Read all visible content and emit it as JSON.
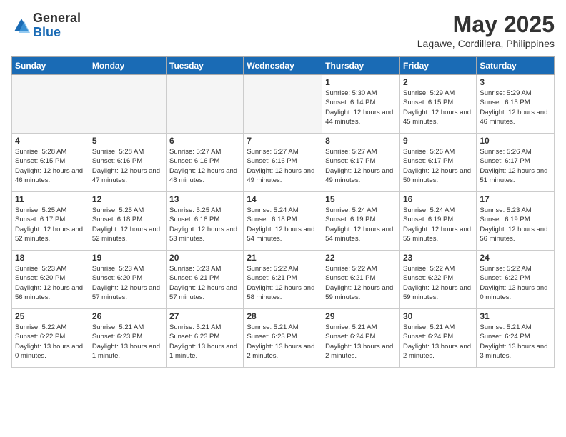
{
  "header": {
    "logo_general": "General",
    "logo_blue": "Blue",
    "month_title": "May 2025",
    "subtitle": "Lagawe, Cordillera, Philippines"
  },
  "weekdays": [
    "Sunday",
    "Monday",
    "Tuesday",
    "Wednesday",
    "Thursday",
    "Friday",
    "Saturday"
  ],
  "weeks": [
    [
      {
        "day": "",
        "sunrise": "",
        "sunset": "",
        "daylight": "",
        "empty": true
      },
      {
        "day": "",
        "sunrise": "",
        "sunset": "",
        "daylight": "",
        "empty": true
      },
      {
        "day": "",
        "sunrise": "",
        "sunset": "",
        "daylight": "",
        "empty": true
      },
      {
        "day": "",
        "sunrise": "",
        "sunset": "",
        "daylight": "",
        "empty": true
      },
      {
        "day": "1",
        "sunrise": "Sunrise: 5:30 AM",
        "sunset": "Sunset: 6:14 PM",
        "daylight": "Daylight: 12 hours and 44 minutes.",
        "empty": false
      },
      {
        "day": "2",
        "sunrise": "Sunrise: 5:29 AM",
        "sunset": "Sunset: 6:15 PM",
        "daylight": "Daylight: 12 hours and 45 minutes.",
        "empty": false
      },
      {
        "day": "3",
        "sunrise": "Sunrise: 5:29 AM",
        "sunset": "Sunset: 6:15 PM",
        "daylight": "Daylight: 12 hours and 46 minutes.",
        "empty": false
      }
    ],
    [
      {
        "day": "4",
        "sunrise": "Sunrise: 5:28 AM",
        "sunset": "Sunset: 6:15 PM",
        "daylight": "Daylight: 12 hours and 46 minutes.",
        "empty": false
      },
      {
        "day": "5",
        "sunrise": "Sunrise: 5:28 AM",
        "sunset": "Sunset: 6:16 PM",
        "daylight": "Daylight: 12 hours and 47 minutes.",
        "empty": false
      },
      {
        "day": "6",
        "sunrise": "Sunrise: 5:27 AM",
        "sunset": "Sunset: 6:16 PM",
        "daylight": "Daylight: 12 hours and 48 minutes.",
        "empty": false
      },
      {
        "day": "7",
        "sunrise": "Sunrise: 5:27 AM",
        "sunset": "Sunset: 6:16 PM",
        "daylight": "Daylight: 12 hours and 49 minutes.",
        "empty": false
      },
      {
        "day": "8",
        "sunrise": "Sunrise: 5:27 AM",
        "sunset": "Sunset: 6:17 PM",
        "daylight": "Daylight: 12 hours and 49 minutes.",
        "empty": false
      },
      {
        "day": "9",
        "sunrise": "Sunrise: 5:26 AM",
        "sunset": "Sunset: 6:17 PM",
        "daylight": "Daylight: 12 hours and 50 minutes.",
        "empty": false
      },
      {
        "day": "10",
        "sunrise": "Sunrise: 5:26 AM",
        "sunset": "Sunset: 6:17 PM",
        "daylight": "Daylight: 12 hours and 51 minutes.",
        "empty": false
      }
    ],
    [
      {
        "day": "11",
        "sunrise": "Sunrise: 5:25 AM",
        "sunset": "Sunset: 6:17 PM",
        "daylight": "Daylight: 12 hours and 52 minutes.",
        "empty": false
      },
      {
        "day": "12",
        "sunrise": "Sunrise: 5:25 AM",
        "sunset": "Sunset: 6:18 PM",
        "daylight": "Daylight: 12 hours and 52 minutes.",
        "empty": false
      },
      {
        "day": "13",
        "sunrise": "Sunrise: 5:25 AM",
        "sunset": "Sunset: 6:18 PM",
        "daylight": "Daylight: 12 hours and 53 minutes.",
        "empty": false
      },
      {
        "day": "14",
        "sunrise": "Sunrise: 5:24 AM",
        "sunset": "Sunset: 6:18 PM",
        "daylight": "Daylight: 12 hours and 54 minutes.",
        "empty": false
      },
      {
        "day": "15",
        "sunrise": "Sunrise: 5:24 AM",
        "sunset": "Sunset: 6:19 PM",
        "daylight": "Daylight: 12 hours and 54 minutes.",
        "empty": false
      },
      {
        "day": "16",
        "sunrise": "Sunrise: 5:24 AM",
        "sunset": "Sunset: 6:19 PM",
        "daylight": "Daylight: 12 hours and 55 minutes.",
        "empty": false
      },
      {
        "day": "17",
        "sunrise": "Sunrise: 5:23 AM",
        "sunset": "Sunset: 6:19 PM",
        "daylight": "Daylight: 12 hours and 56 minutes.",
        "empty": false
      }
    ],
    [
      {
        "day": "18",
        "sunrise": "Sunrise: 5:23 AM",
        "sunset": "Sunset: 6:20 PM",
        "daylight": "Daylight: 12 hours and 56 minutes.",
        "empty": false
      },
      {
        "day": "19",
        "sunrise": "Sunrise: 5:23 AM",
        "sunset": "Sunset: 6:20 PM",
        "daylight": "Daylight: 12 hours and 57 minutes.",
        "empty": false
      },
      {
        "day": "20",
        "sunrise": "Sunrise: 5:23 AM",
        "sunset": "Sunset: 6:21 PM",
        "daylight": "Daylight: 12 hours and 57 minutes.",
        "empty": false
      },
      {
        "day": "21",
        "sunrise": "Sunrise: 5:22 AM",
        "sunset": "Sunset: 6:21 PM",
        "daylight": "Daylight: 12 hours and 58 minutes.",
        "empty": false
      },
      {
        "day": "22",
        "sunrise": "Sunrise: 5:22 AM",
        "sunset": "Sunset: 6:21 PM",
        "daylight": "Daylight: 12 hours and 59 minutes.",
        "empty": false
      },
      {
        "day": "23",
        "sunrise": "Sunrise: 5:22 AM",
        "sunset": "Sunset: 6:22 PM",
        "daylight": "Daylight: 12 hours and 59 minutes.",
        "empty": false
      },
      {
        "day": "24",
        "sunrise": "Sunrise: 5:22 AM",
        "sunset": "Sunset: 6:22 PM",
        "daylight": "Daylight: 13 hours and 0 minutes.",
        "empty": false
      }
    ],
    [
      {
        "day": "25",
        "sunrise": "Sunrise: 5:22 AM",
        "sunset": "Sunset: 6:22 PM",
        "daylight": "Daylight: 13 hours and 0 minutes.",
        "empty": false
      },
      {
        "day": "26",
        "sunrise": "Sunrise: 5:21 AM",
        "sunset": "Sunset: 6:23 PM",
        "daylight": "Daylight: 13 hours and 1 minute.",
        "empty": false
      },
      {
        "day": "27",
        "sunrise": "Sunrise: 5:21 AM",
        "sunset": "Sunset: 6:23 PM",
        "daylight": "Daylight: 13 hours and 1 minute.",
        "empty": false
      },
      {
        "day": "28",
        "sunrise": "Sunrise: 5:21 AM",
        "sunset": "Sunset: 6:23 PM",
        "daylight": "Daylight: 13 hours and 2 minutes.",
        "empty": false
      },
      {
        "day": "29",
        "sunrise": "Sunrise: 5:21 AM",
        "sunset": "Sunset: 6:24 PM",
        "daylight": "Daylight: 13 hours and 2 minutes.",
        "empty": false
      },
      {
        "day": "30",
        "sunrise": "Sunrise: 5:21 AM",
        "sunset": "Sunset: 6:24 PM",
        "daylight": "Daylight: 13 hours and 2 minutes.",
        "empty": false
      },
      {
        "day": "31",
        "sunrise": "Sunrise: 5:21 AM",
        "sunset": "Sunset: 6:24 PM",
        "daylight": "Daylight: 13 hours and 3 minutes.",
        "empty": false
      }
    ]
  ]
}
